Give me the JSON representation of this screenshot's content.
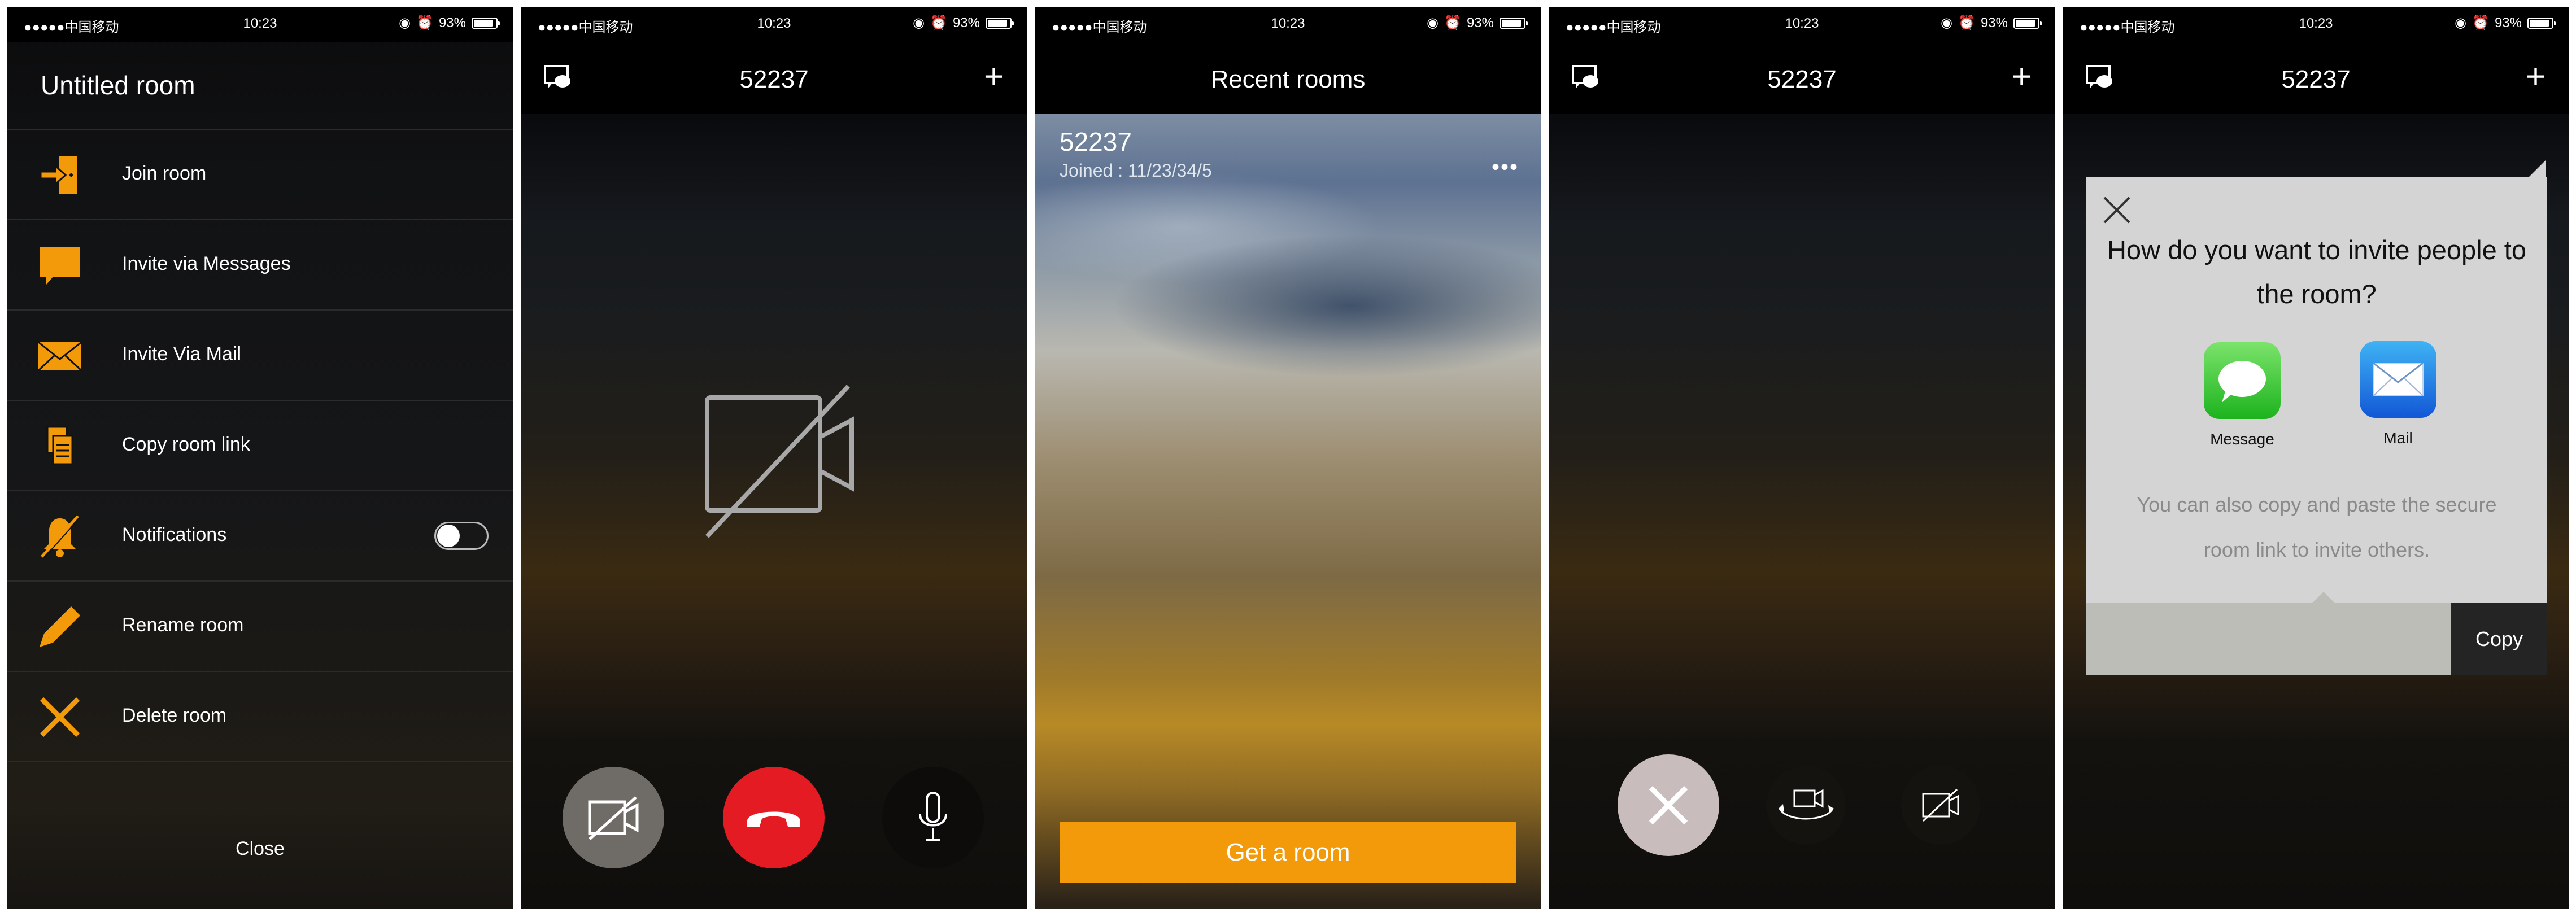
{
  "status": {
    "carrier": "●●●●●中国移动",
    "time": "10:23",
    "battery": "93%"
  },
  "menu_screen": {
    "room_title": "Untitled room",
    "items": [
      {
        "label": "Join room",
        "icon": "join-room-icon"
      },
      {
        "label": "Invite via Messages",
        "icon": "message-bubble-icon"
      },
      {
        "label": "Invite Via Mail",
        "icon": "mail-icon"
      },
      {
        "label": "Copy room link",
        "icon": "copy-icon"
      },
      {
        "label": "Notifications",
        "icon": "bell-muted-icon",
        "toggle": false
      },
      {
        "label": "Rename room",
        "icon": "pencil-icon"
      },
      {
        "label": "Delete room",
        "icon": "delete-x-icon"
      }
    ],
    "close_label": "Close",
    "accent": "#f39a0b"
  },
  "call_screen": {
    "title": "52237",
    "add_label": "+"
  },
  "recent_screen": {
    "title": "Recent rooms",
    "room": {
      "name": "52237",
      "joined": "Joined : 11/23/34/5",
      "more": "•••"
    },
    "button_label": "Get a room",
    "button_color": "#f39a0b"
  },
  "call_screen2": {
    "title": "52237",
    "add_label": "+"
  },
  "invite_screen": {
    "title": "52237",
    "add_label": "+",
    "question": "How do you want to invite people to the room?",
    "apps": [
      {
        "label": "Message",
        "icon": "messages-app-icon"
      },
      {
        "label": "Mail",
        "icon": "mail-app-icon"
      }
    ],
    "note": "You can also copy and paste the secure room link to invite others.",
    "copy_label": "Copy"
  }
}
